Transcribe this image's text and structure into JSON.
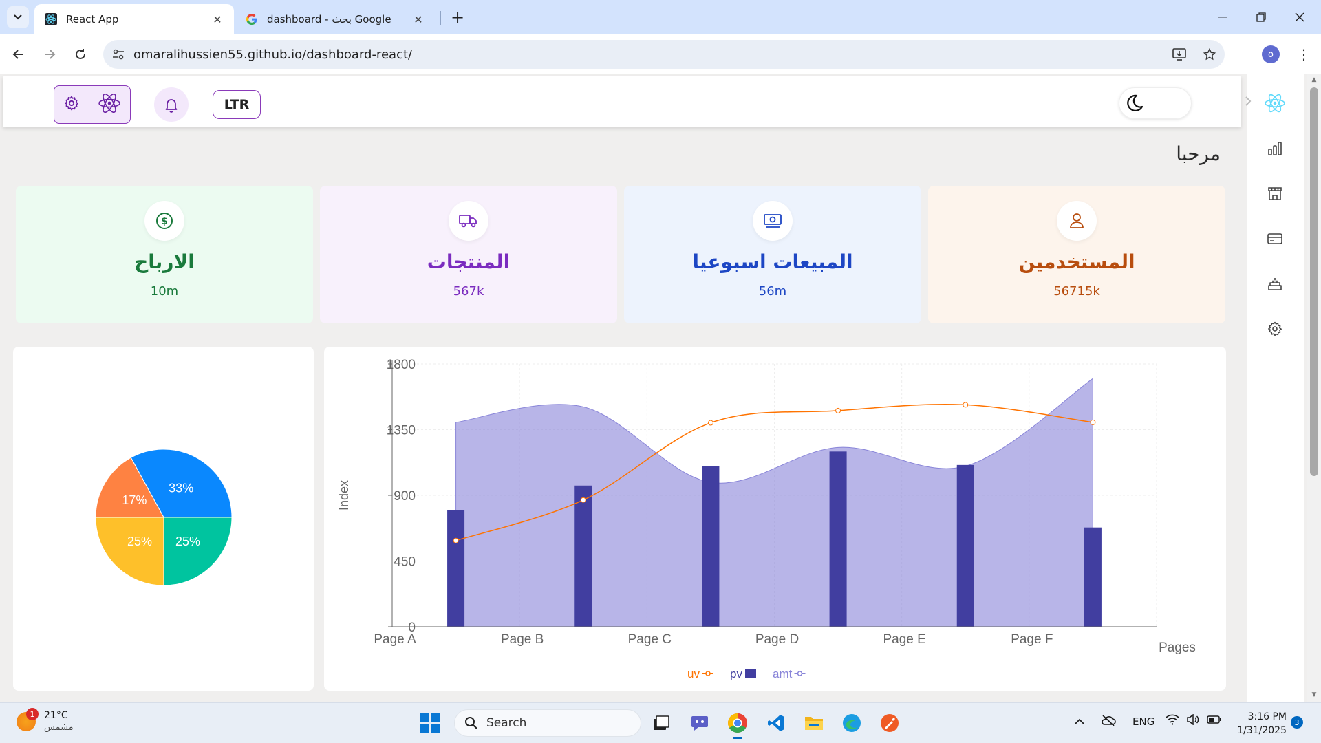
{
  "browser": {
    "tabs": [
      {
        "title": "React App",
        "active": true
      },
      {
        "title": "dashboard - بحث Google",
        "active": false
      }
    ],
    "url": "omaralihussien55.github.io/dashboard-react/",
    "profile_initial": "o"
  },
  "header": {
    "dir_toggle_label": "LTR"
  },
  "welcome": "مرحبا",
  "cards": [
    {
      "title": "الارباح",
      "value": "10m",
      "icon": "dollar-icon",
      "color": "#1a7a3c",
      "bg": "#ecfbf1"
    },
    {
      "title": "المنتجات",
      "value": "567k",
      "icon": "truck-icon",
      "color": "#7b2cbf",
      "bg": "#f8f1fc"
    },
    {
      "title": "المبيعات اسبوعيا",
      "value": "56m",
      "icon": "money-icon",
      "color": "#1d46c4",
      "bg": "#edf3fd"
    },
    {
      "title": "المستخدمين",
      "value": "56715k",
      "icon": "user-icon",
      "color": "#b84d0e",
      "bg": "#fdf4ec"
    }
  ],
  "chart_data": [
    {
      "type": "pie",
      "slices": [
        {
          "value": 33,
          "label": "33%",
          "color": "#0a88fe"
        },
        {
          "value": 17,
          "label": "17%",
          "color": "#fe8242"
        },
        {
          "value": 25,
          "label": "25%",
          "color": "#fec02a"
        },
        {
          "value": 25,
          "label": "25%",
          "color": "#00c49f"
        }
      ]
    },
    {
      "type": "bar",
      "categories": [
        "Page A",
        "Page B",
        "Page C",
        "Page D",
        "Page E",
        "Page F"
      ],
      "xlabel": "Pages",
      "ylabel": "Index",
      "ylim": [
        0,
        1800
      ],
      "yticks": [
        "0",
        "450",
        "900",
        "1350",
        "1800"
      ],
      "grid": true,
      "legend_position": "bottom",
      "series": [
        {
          "name": "uv",
          "type": "line",
          "color": "#ff7300",
          "values": [
            590,
            868,
            1397,
            1480,
            1520,
            1400
          ]
        },
        {
          "name": "pv",
          "type": "bar",
          "color": "#413ea0",
          "values": [
            800,
            967,
            1098,
            1200,
            1108,
            680
          ]
        },
        {
          "name": "amt",
          "type": "area",
          "color": "#8884d8",
          "values": [
            1400,
            1506,
            989,
            1228,
            1100,
            1700
          ]
        }
      ]
    }
  ],
  "taskbar": {
    "weather_temp": "21°C",
    "weather_desc": "مشمس",
    "weather_badge": "1",
    "search_label": "Search",
    "lang": "ENG",
    "time": "3:16 PM",
    "date": "1/31/2025",
    "notif_count": "3"
  }
}
